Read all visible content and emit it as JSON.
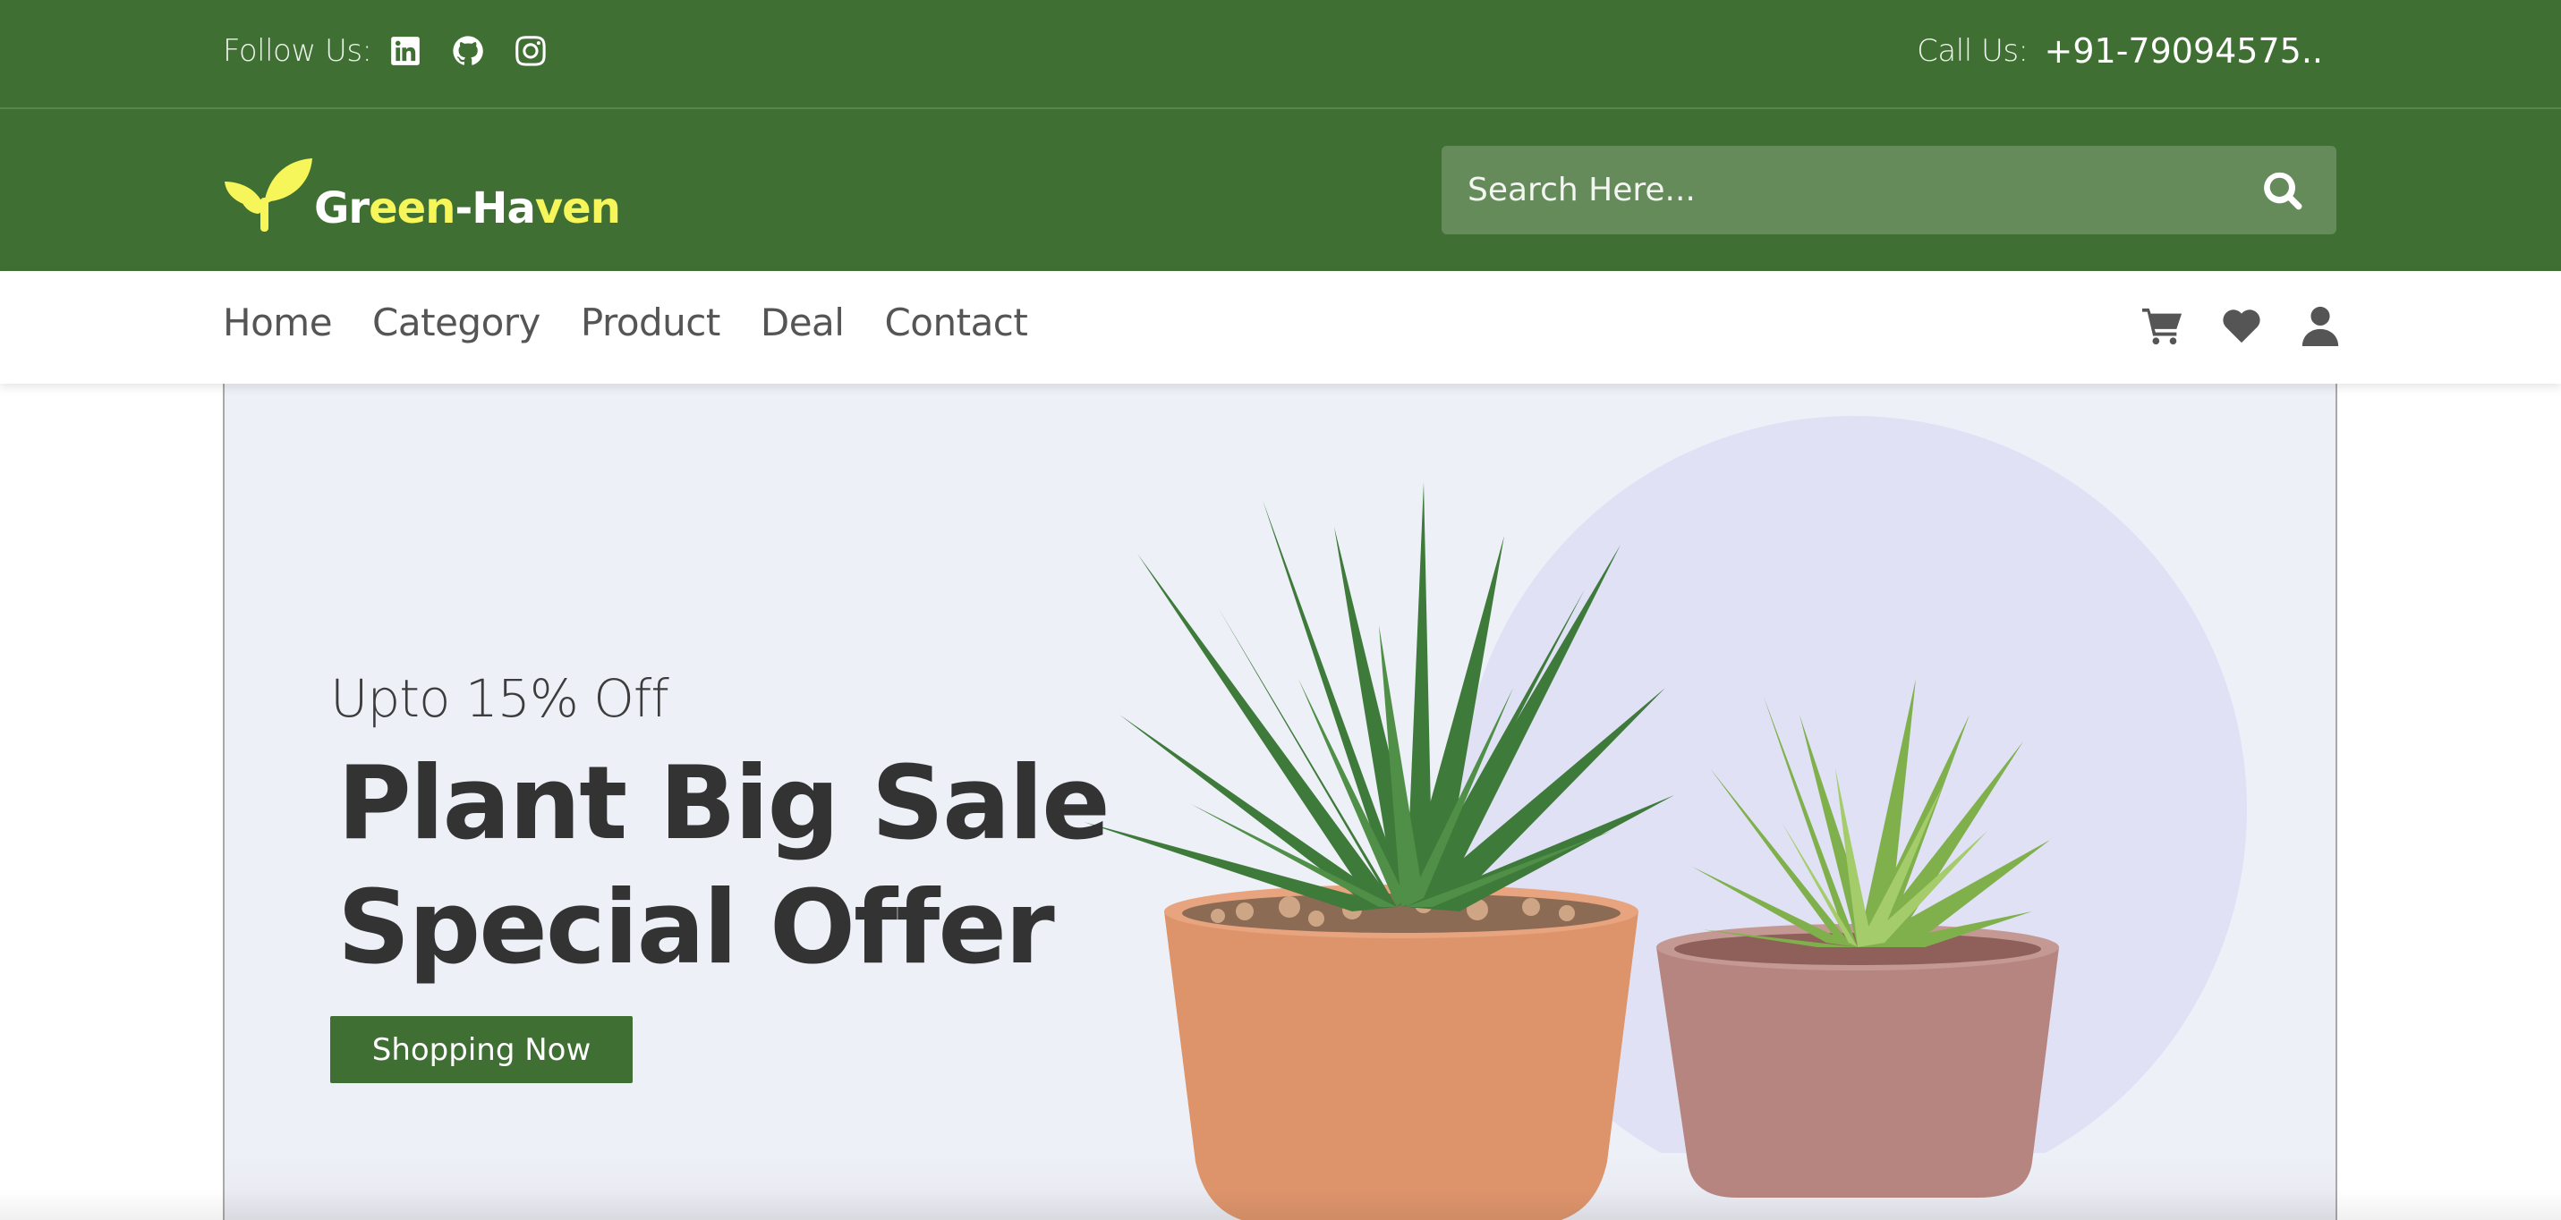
{
  "topbar": {
    "follow_label": "Follow Us:",
    "social_icons": [
      "linkedin-icon",
      "github-icon",
      "instagram-icon"
    ],
    "call_label": "Call Us:",
    "call_number": "+91-79094575.."
  },
  "header": {
    "logo_text_part1": "Gr",
    "logo_text_part2": "een",
    "logo_text_part3": "-Ha",
    "logo_text_part4": "ven",
    "search_placeholder": "Search Here...",
    "search_value": ""
  },
  "nav": {
    "links": [
      "Home",
      "Category",
      "Product",
      "Deal",
      "Contact"
    ],
    "icons": [
      "cart-icon",
      "heart-icon",
      "user-icon"
    ]
  },
  "hero": {
    "subtitle": "Upto 15% Off",
    "title_line1": "Plant Big Sale",
    "title_line2": "Special Offer",
    "button_label": "Shopping Now"
  },
  "colors": {
    "brand_green": "#3f6f33",
    "search_bg": "#658b5a",
    "logo_yellow": "#f6f55a",
    "hero_bg": "#eef0f8",
    "text_dark": "#333333"
  }
}
